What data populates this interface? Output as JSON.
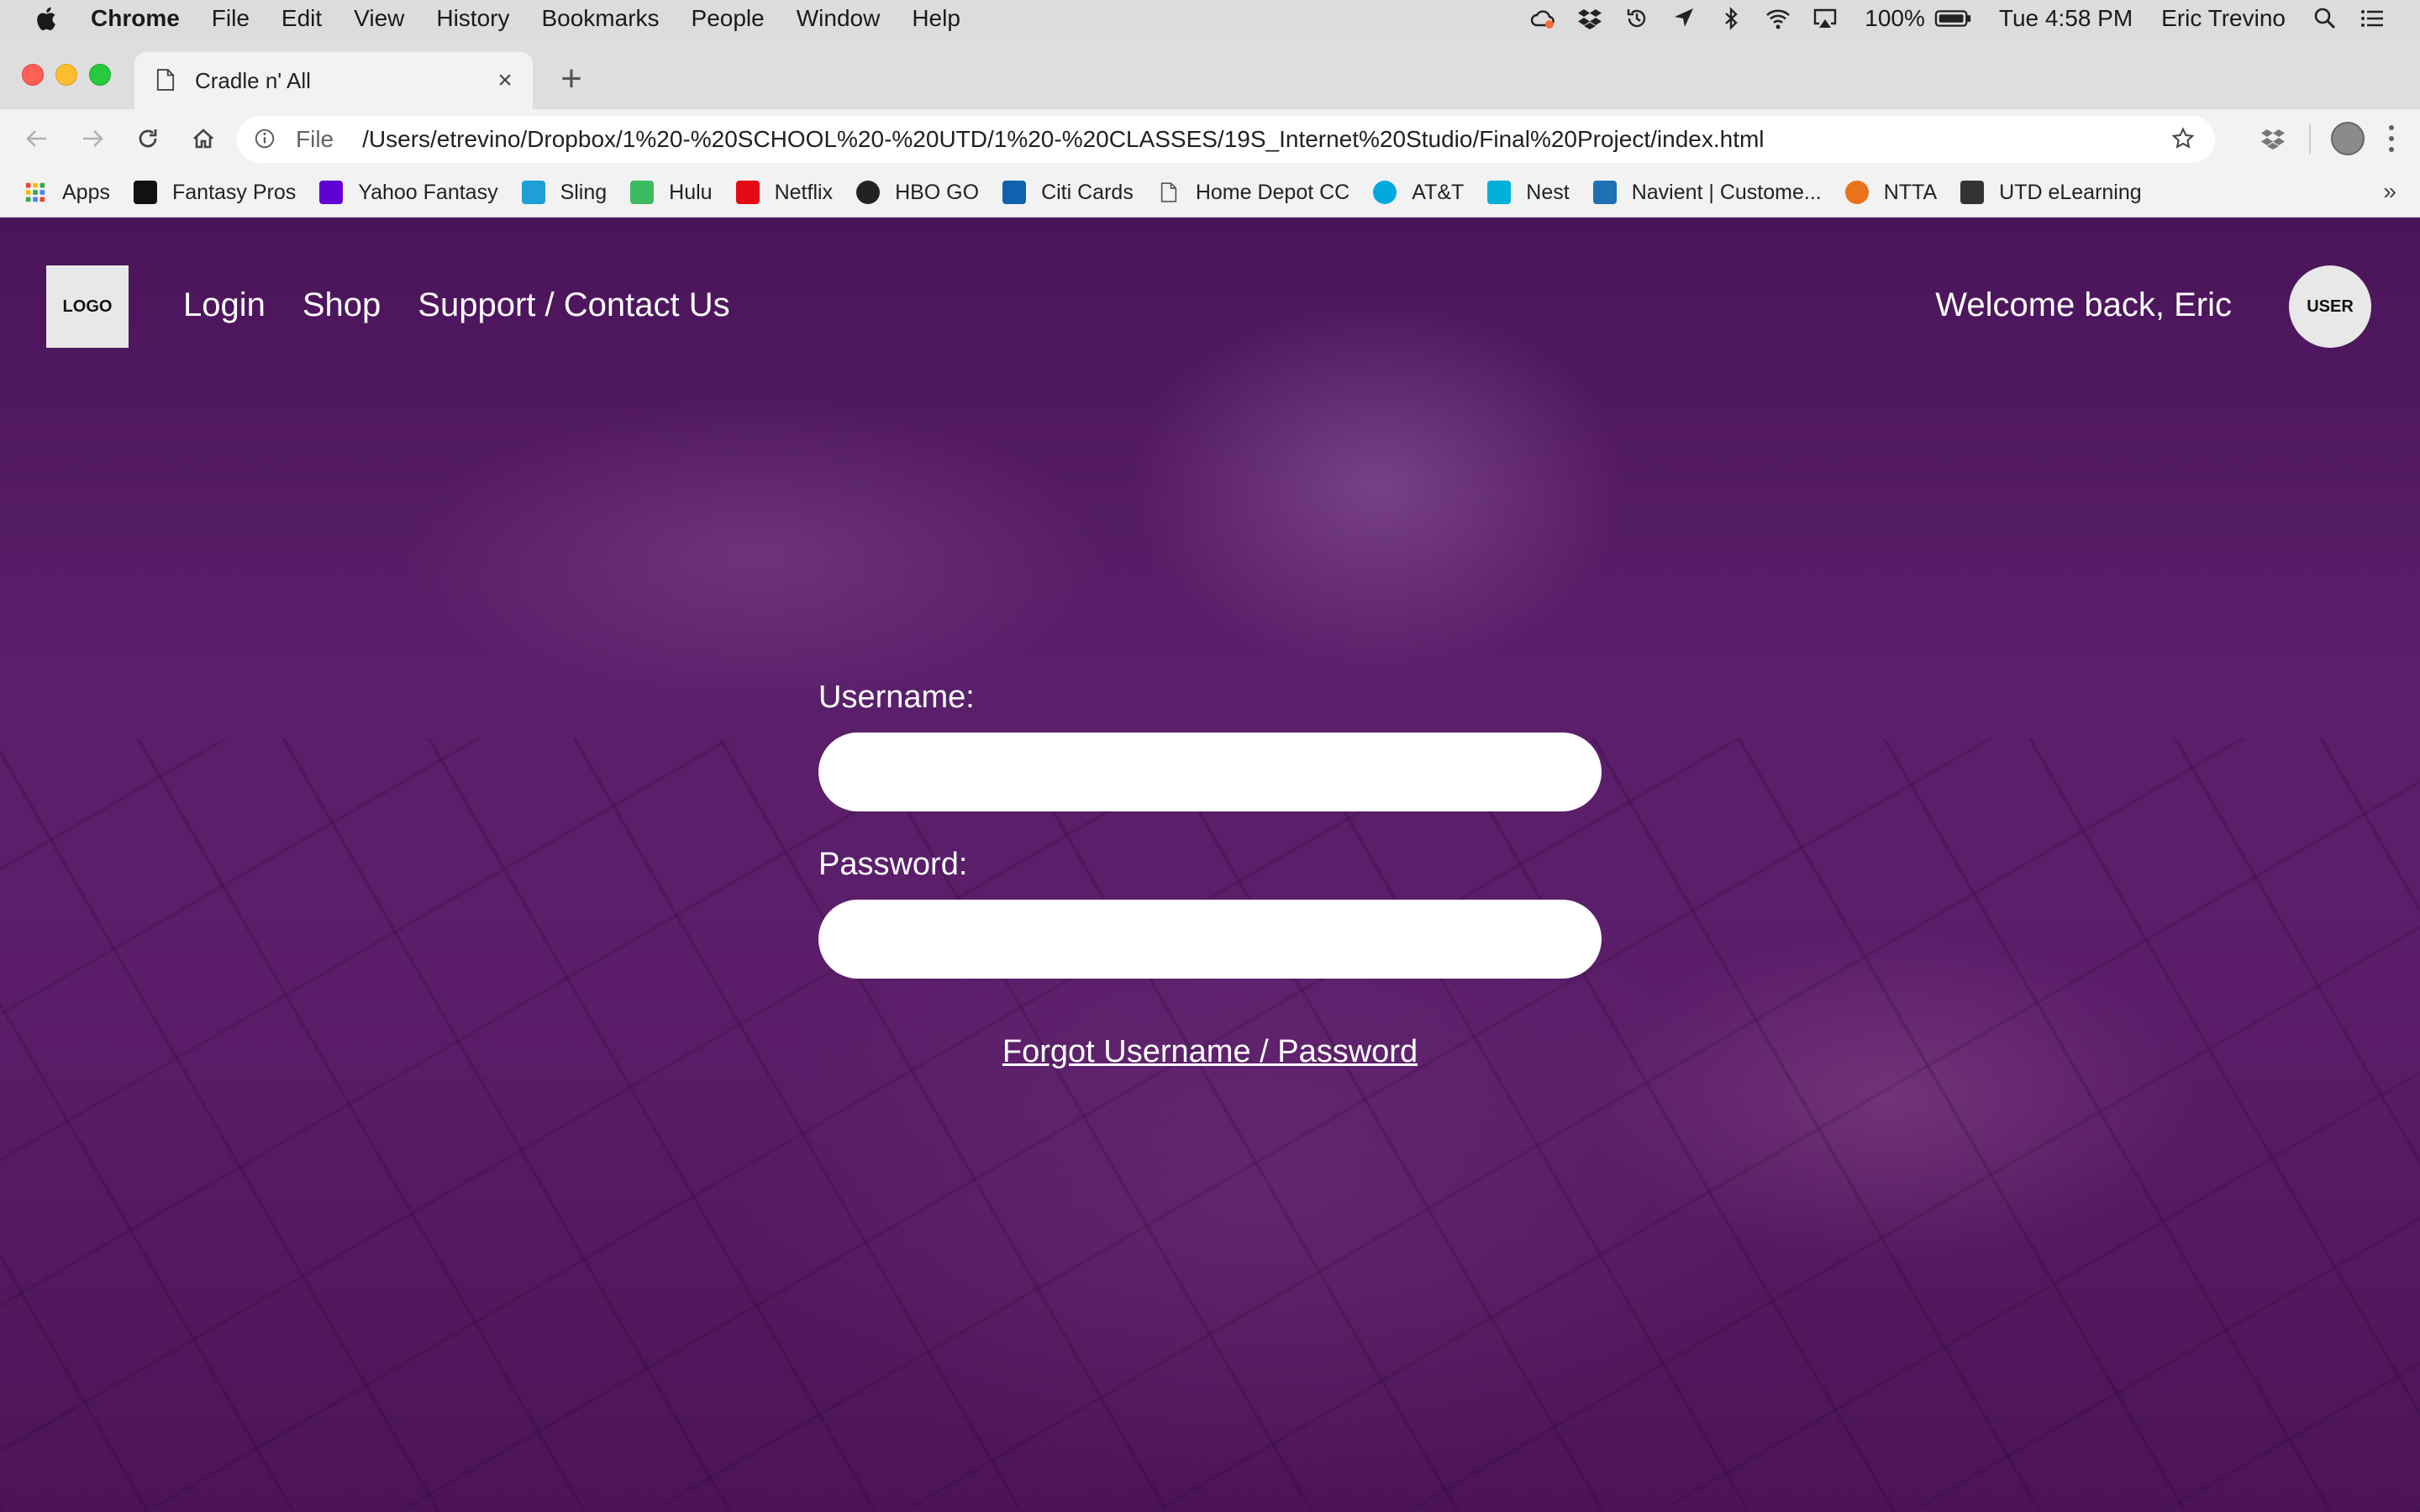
{
  "menubar": {
    "app_name": "Chrome",
    "menus": [
      "File",
      "Edit",
      "View",
      "History",
      "Bookmarks",
      "People",
      "Window",
      "Help"
    ],
    "battery": "100%",
    "clock": "Tue 4:58 PM",
    "user": "Eric Trevino"
  },
  "browser": {
    "tab_title": "Cradle n' All",
    "scheme_label": "File",
    "url": "/Users/etrevino/Dropbox/1%20-%20SCHOOL%20-%20UTD/1%20-%20CLASSES/19S_Internet%20Studio/Final%20Project/index.html"
  },
  "bookmarks": [
    {
      "label": "Apps",
      "icon": "apps-grid-icon",
      "color": "#4285f4"
    },
    {
      "label": "Fantasy Pros",
      "icon": "fantasy-pros-icon",
      "color": "#111111"
    },
    {
      "label": "Yahoo Fantasy",
      "icon": "yahoo-icon",
      "color": "#5f01d1"
    },
    {
      "label": "Sling",
      "icon": "sling-icon",
      "color": "#1ea0d7"
    },
    {
      "label": "Hulu",
      "icon": "hulu-icon",
      "color": "#3dbb61"
    },
    {
      "label": "Netflix",
      "icon": "netflix-icon",
      "color": "#e50914"
    },
    {
      "label": "HBO GO",
      "icon": "hbo-icon",
      "color": "#222222"
    },
    {
      "label": "Citi Cards",
      "icon": "citi-icon",
      "color": "#0f62ae"
    },
    {
      "label": "Home Depot CC",
      "icon": "page-icon",
      "color": "#888888"
    },
    {
      "label": "AT&T",
      "icon": "att-icon",
      "color": "#00a8e0"
    },
    {
      "label": "Nest",
      "icon": "nest-icon",
      "color": "#00afd8"
    },
    {
      "label": "Navient | Custome...",
      "icon": "navient-icon",
      "color": "#1f6fb5"
    },
    {
      "label": "NTTA",
      "icon": "ntta-icon",
      "color": "#e8731a"
    },
    {
      "label": "UTD eLearning",
      "icon": "blackboard-icon",
      "color": "#333333"
    }
  ],
  "site": {
    "logo": "LOGO",
    "nav": [
      "Login",
      "Shop",
      "Support / Contact Us"
    ],
    "welcome": "Welcome back, Eric",
    "user_avatar": "USER",
    "username_label": "Username:",
    "username_value": "",
    "password_label": "Password:",
    "password_value": "",
    "forgot_link": "Forgot Username / Password",
    "overlay_color": "#5a1f6b"
  }
}
